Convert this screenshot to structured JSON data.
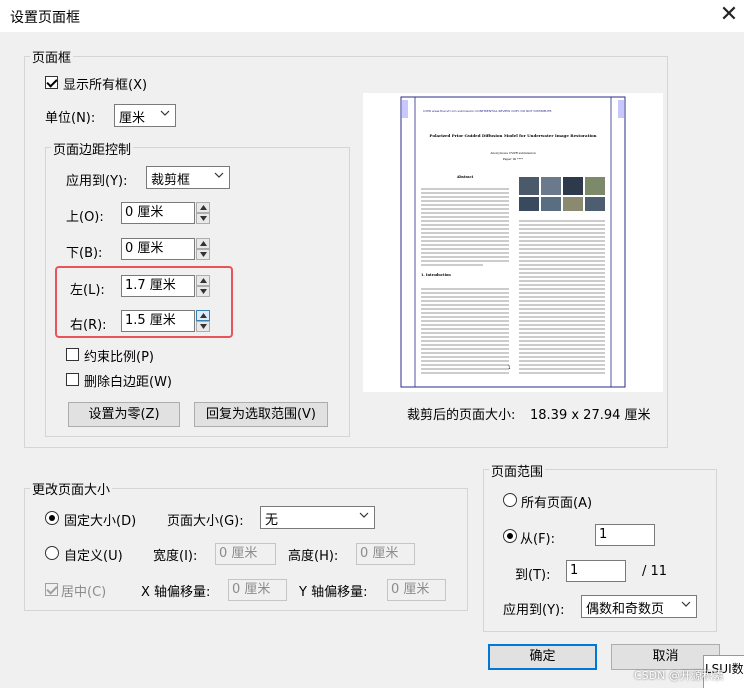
{
  "window": {
    "title": "设置页面框",
    "close_glyph": "✕"
  },
  "page_box": {
    "legend": "页面框",
    "show_all_boxes": {
      "label": "显示所有框(X)",
      "checked": true
    },
    "unit": {
      "label": "单位(N):",
      "value": "厘米"
    }
  },
  "margins": {
    "legend": "页面边距控制",
    "apply_to": {
      "label": "应用到(Y):",
      "value": "裁剪框"
    },
    "top": {
      "label": "上(O):",
      "value": "0 厘米"
    },
    "bottom": {
      "label": "下(B):",
      "value": "0 厘米"
    },
    "left": {
      "label": "左(L):",
      "value": "1.7 厘米"
    },
    "right": {
      "label": "右(R):",
      "value": "1.5 厘米"
    },
    "constrain": {
      "label": "约束比例(P)",
      "checked": false
    },
    "remove_white": {
      "label": "删除白边距(W)",
      "checked": false
    },
    "set_zero_label": "设置为零(Z)",
    "revert_label": "回复为选取范围(V)"
  },
  "preview": {
    "header_line": "CVPR www.thecvf.com submission  CONFIDENTIAL REVIEW COPY. DO NOT DISTRIBUTE.",
    "paper_title": "Polarized Prior Guided Diffusion Model for Underwater Image Restoration",
    "author_line": "Anonymous CVPR submission",
    "paper_id": "Paper ID ****",
    "abstract_heading": "Abstract",
    "intro_heading": "1. Introduction",
    "page_number": "1",
    "size_label": "裁剪后的页面大小:",
    "size_value": "18.39 x 27.94 厘米"
  },
  "change_size": {
    "legend": "更改页面大小",
    "fixed_size": {
      "label": "固定大小(D)",
      "checked": true
    },
    "page_size_label": "页面大小(G):",
    "page_size_value": "无",
    "custom": {
      "label": "自定义(U)",
      "checked": false
    },
    "width_label": "宽度(I):",
    "width_value": "0 厘米",
    "height_label": "高度(H):",
    "height_value": "0 厘米",
    "center": {
      "label": "居中(C)",
      "checked": true,
      "enabled": false
    },
    "x_offset_label": "X 轴偏移量:",
    "x_offset_value": "0 厘米",
    "y_offset_label": "Y 轴偏移量:",
    "y_offset_value": "0 厘米"
  },
  "page_range": {
    "legend": "页面范围",
    "all_pages": {
      "label": "所有页面(A)",
      "checked": false
    },
    "from": {
      "label": "从(F):",
      "value": "1",
      "checked": true
    },
    "to": {
      "label": "到(T):",
      "value": "1",
      "total": "/ 11"
    },
    "apply_to": {
      "label": "应用到(Y):",
      "value": "偶数和奇数页"
    }
  },
  "footer": {
    "ok_label": "确定",
    "cancel_label": "取消",
    "overlay_text": "LSUI数",
    "watermark": "CSDN @开源积累"
  },
  "colors": {
    "default_button_border": "#0078d7",
    "highlight_border": "#e8545c",
    "preview_page_border": "#2b2b8a"
  }
}
